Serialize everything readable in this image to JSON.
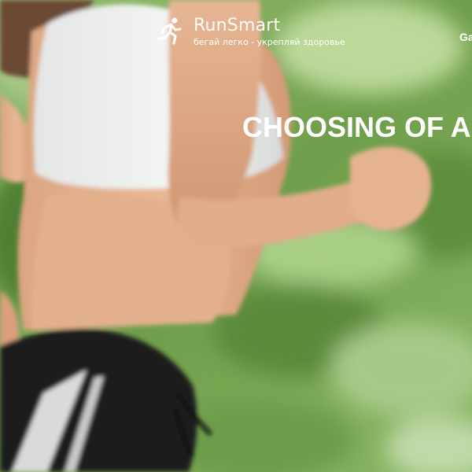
{
  "header": {
    "logo": {
      "title": "RunSmart",
      "tagline": "бегай легко - укрепляй здоровье",
      "icon": "runner-icon"
    },
    "nav": [
      {
        "label": "Ga"
      }
    ]
  },
  "hero": {
    "title": "CHOOSING OF A"
  },
  "colors": {
    "text": "#ffffff",
    "background_green": "#7fae5a"
  }
}
